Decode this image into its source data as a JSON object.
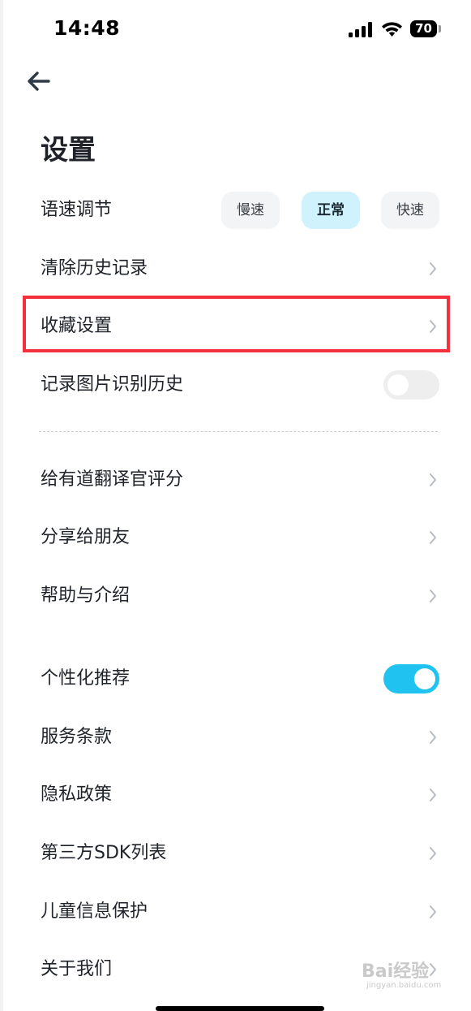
{
  "status_bar": {
    "time": "14:48",
    "battery": "70"
  },
  "page": {
    "title": "设置"
  },
  "speed": {
    "label": "语速调节",
    "options": [
      "慢速",
      "正常",
      "快速"
    ],
    "selected": "正常"
  },
  "rows": {
    "clear_history": "清除历史记录",
    "favorites_settings": "收藏设置",
    "record_image_history": "记录图片识别历史",
    "rate_app": "给有道翻译官评分",
    "share": "分享给朋友",
    "help": "帮助与介绍",
    "personalized": "个性化推荐",
    "terms": "服务条款",
    "privacy": "隐私政策",
    "third_party_sdk": "第三方SDK列表",
    "child_protection": "儿童信息保护",
    "about": "关于我们"
  },
  "toggles": {
    "record_image_history": false,
    "personalized": true
  },
  "colors": {
    "accent": "#20c3ef",
    "highlight": "#f2313d",
    "selected_chip": "#cff2fd"
  },
  "watermark": {
    "brand": "Bai经验",
    "url": "jingyan.baidu.com"
  }
}
